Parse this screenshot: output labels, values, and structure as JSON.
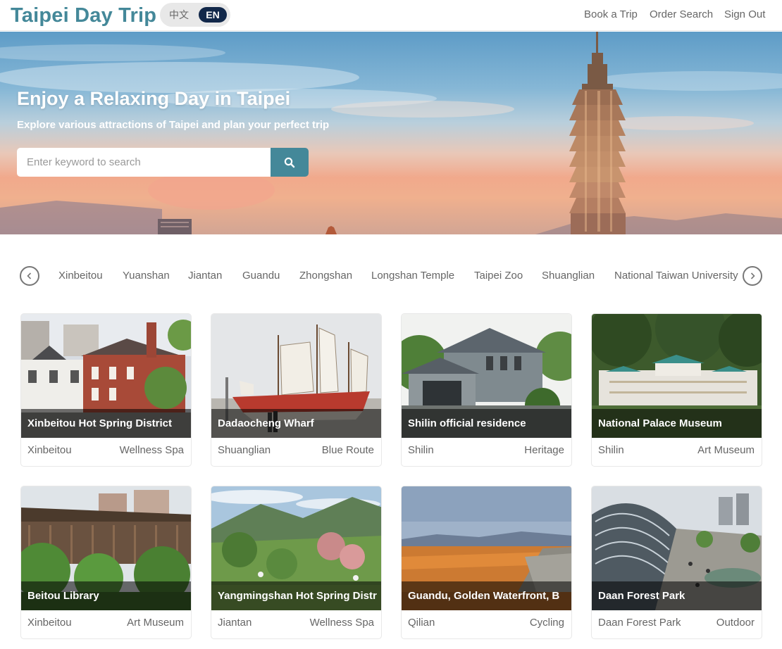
{
  "header": {
    "logo": "Taipei Day Trip",
    "lang_zh": "中文",
    "lang_en": "EN",
    "nav": {
      "book": "Book a Trip",
      "order": "Order Search",
      "signout": "Sign Out"
    }
  },
  "hero": {
    "title": "Enjoy a Relaxing Day in Taipei",
    "subtitle": "Explore various attractions of Taipei and plan your perfect trip",
    "search_placeholder": "Enter keyword to search",
    "search_icon": "search-icon"
  },
  "categories": {
    "prev_icon": "chevron-left-icon",
    "next_icon": "chevron-right-icon",
    "items": [
      "Xinbeitou",
      "Yuanshan",
      "Jiantan",
      "Guandu",
      "Zhongshan",
      "Longshan Temple",
      "Taipei Zoo",
      "Shuanglian",
      "National Taiwan University"
    ]
  },
  "attractions": [
    {
      "name": "Xinbeitou Hot Spring District",
      "mrt": "Xinbeitou",
      "category": "Wellness Spa"
    },
    {
      "name": "Dadaocheng Wharf",
      "mrt": "Shuanglian",
      "category": "Blue Route"
    },
    {
      "name": "Shilin official residence",
      "mrt": "Shilin",
      "category": "Heritage"
    },
    {
      "name": "National Palace Museum",
      "mrt": "Shilin",
      "category": "Art Museum"
    },
    {
      "name": "Beitou Library",
      "mrt": "Xinbeitou",
      "category": "Art Museum"
    },
    {
      "name": "Yangmingshan Hot Spring Distr",
      "mrt": "Jiantan",
      "category": "Wellness Spa"
    },
    {
      "name": "Guandu, Golden Waterfront, B",
      "mrt": "Qilian",
      "category": "Cycling"
    },
    {
      "name": "Daan Forest Park",
      "mrt": "Daan Forest Park",
      "category": "Outdoor"
    }
  ]
}
